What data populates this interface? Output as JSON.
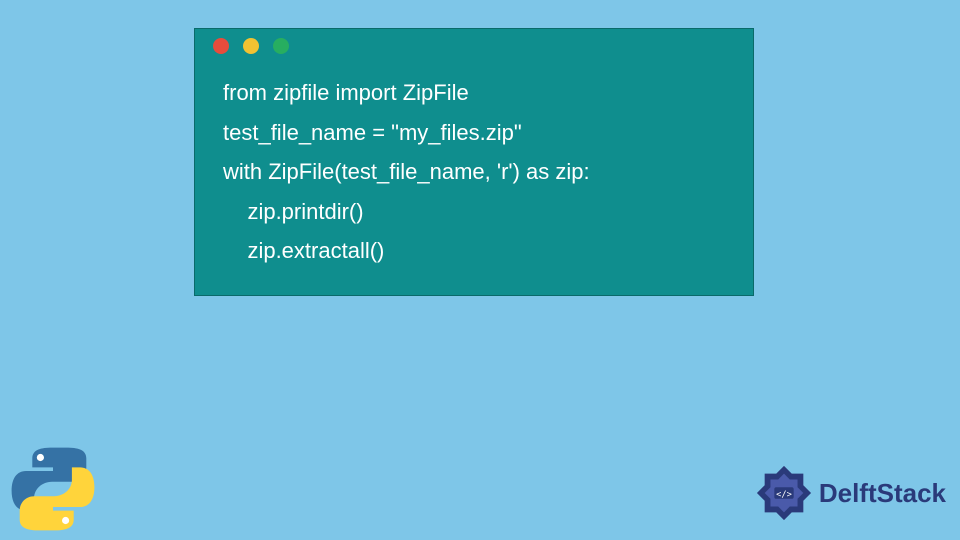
{
  "code": {
    "lines": [
      "from zipfile import ZipFile",
      "",
      "test_file_name = \"my_files.zip\"",
      "",
      "with ZipFile(test_file_name, 'r') as zip:",
      "    zip.printdir()",
      "    zip.extractall()"
    ]
  },
  "window": {
    "buttons": [
      "close",
      "minimize",
      "maximize"
    ]
  },
  "branding": {
    "site_name": "DelftStack",
    "language_icon": "python"
  },
  "colors": {
    "background": "#7ec6e8",
    "code_bg": "#0f8e8e",
    "code_text": "#ffffff",
    "brand_text": "#2a3a7a"
  }
}
